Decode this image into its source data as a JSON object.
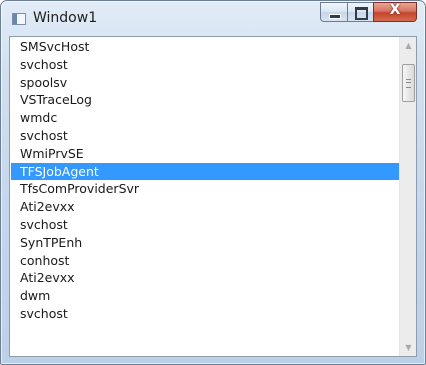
{
  "window": {
    "title": "Window1",
    "buttons": {
      "minimize_icon": "minimize-icon",
      "maximize_icon": "maximize-icon",
      "close_icon": "close-icon",
      "close_glyph": "X"
    }
  },
  "listbox": {
    "items": [
      {
        "label": "SMSvcHost",
        "selected": false
      },
      {
        "label": "svchost",
        "selected": false
      },
      {
        "label": "spoolsv",
        "selected": false
      },
      {
        "label": "VSTraceLog",
        "selected": false
      },
      {
        "label": "wmdc",
        "selected": false
      },
      {
        "label": "svchost",
        "selected": false
      },
      {
        "label": "WmiPrvSE",
        "selected": false
      },
      {
        "label": "TFSJobAgent",
        "selected": true
      },
      {
        "label": "TfsComProviderSvr",
        "selected": false
      },
      {
        "label": "Ati2evxx",
        "selected": false
      },
      {
        "label": "svchost",
        "selected": false
      },
      {
        "label": "SynTPEnh",
        "selected": false
      },
      {
        "label": "conhost",
        "selected": false
      },
      {
        "label": "Ati2evxx",
        "selected": false
      },
      {
        "label": "dwm",
        "selected": false
      },
      {
        "label": "svchost",
        "selected": false
      }
    ],
    "selected_color": "#3399ff"
  },
  "scrollbar": {
    "up_glyph": "▲",
    "down_glyph": "▼"
  }
}
